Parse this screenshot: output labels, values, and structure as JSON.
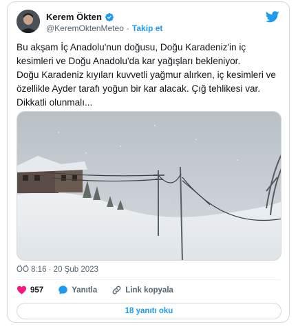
{
  "author": {
    "name": "Kerem Ökten",
    "handle": "@KeremOktenMeteo",
    "separator": "·",
    "follow_label": "Takip et"
  },
  "tweet": {
    "text_line_1": "Bu akşam İç Anadolu'nun doğusu, Doğu Karadeniz'in iç kesimleri ve Doğu Anadolu'da kar yağışları bekleniyor.",
    "text_line_2": "Doğu Karadeniz kıyıları kuvvetli yağmur alırken, iç kesimleri ve özellikle Ayder tarafı yoğun bir kar alacak. Çığ tehlikesi var. Dikkatli olunmalı...",
    "timestamp": "ÖÖ 8:16 · 20 Şub 2023"
  },
  "actions": {
    "like_count": "957",
    "reply_label": "Yanıtla",
    "copy_link_label": "Link kopyala"
  },
  "read_replies_label": "18 yanıtı oku",
  "colors": {
    "accent": "#1d9bf0",
    "like": "#f91880",
    "text": "#0f1419",
    "muted": "#536471",
    "border": "#cfd9de"
  },
  "icons": [
    "verified-badge-icon",
    "twitter-bird-icon",
    "heart-icon",
    "reply-bubble-icon",
    "link-icon"
  ]
}
